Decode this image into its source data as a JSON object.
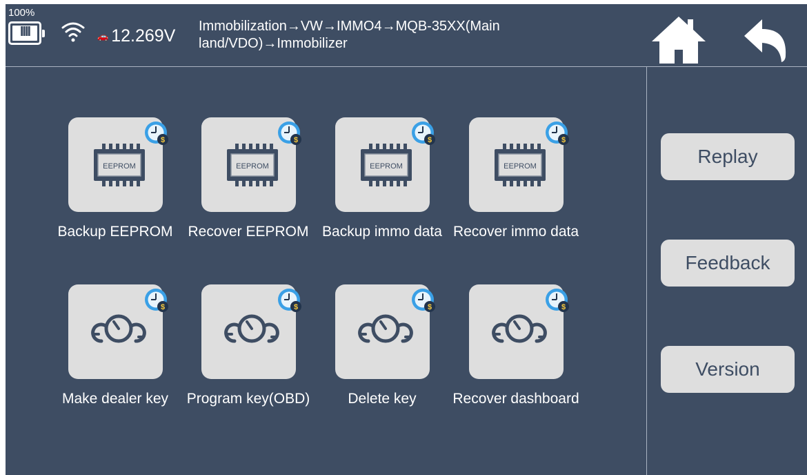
{
  "status": {
    "battery_percent": "100%",
    "voltage": "12.269V"
  },
  "breadcrumb": {
    "path": "Immobilization→VW→IMMO4→MQB-35XX(Main land/VDO)→Immobilizer"
  },
  "nav": {
    "home_icon": "home-icon",
    "back_icon": "back-arrow-icon"
  },
  "functions": [
    {
      "label": "Backup EEPROM",
      "icon": "eeprom-chip-icon",
      "chip_text": "EEPROM"
    },
    {
      "label": "Recover EEPROM",
      "icon": "eeprom-chip-icon",
      "chip_text": "EEPROM"
    },
    {
      "label": "Backup immo data",
      "icon": "eeprom-chip-icon",
      "chip_text": "EEPROM"
    },
    {
      "label": "Recover immo data",
      "icon": "eeprom-chip-icon",
      "chip_text": "EEPROM"
    },
    {
      "label": "Make dealer key",
      "icon": "key-coins-icon"
    },
    {
      "label": "Program key(OBD)",
      "icon": "key-coins-icon"
    },
    {
      "label": "Delete key",
      "icon": "key-coins-icon"
    },
    {
      "label": "Recover dashboard",
      "icon": "key-coins-icon"
    }
  ],
  "side_buttons": {
    "replay": "Replay",
    "feedback": "Feedback",
    "version": "Version"
  },
  "colors": {
    "background": "#3e4d63",
    "tile": "#dedede",
    "badge_blue": "#3aa0e6",
    "badge_dark": "#22344c",
    "badge_coin": "#f3c63c"
  }
}
